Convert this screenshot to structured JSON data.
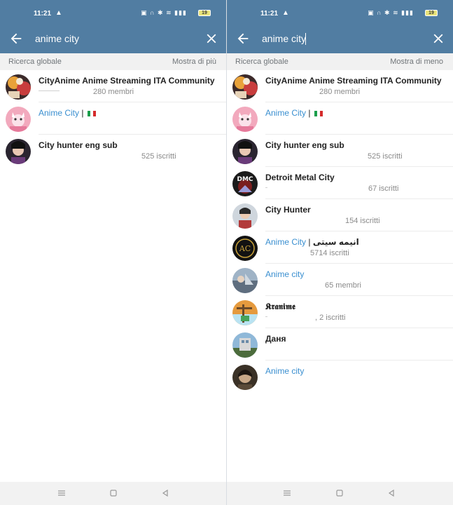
{
  "status": {
    "time": "11:21",
    "battery": "19"
  },
  "left": {
    "search": {
      "value": "anime city"
    },
    "section": {
      "title": "Ricerca globale",
      "toggle": "Mostra di più"
    },
    "results": [
      {
        "title": "CityAnime Anime Streaming ITA Community",
        "subtitle": "280 membri"
      },
      {
        "title": "Anime City",
        "separator": "|"
      },
      {
        "title": "City hunter eng sub",
        "subtitle": "525 iscritti"
      }
    ]
  },
  "right": {
    "search": {
      "value": "anime city"
    },
    "section": {
      "title": "Ricerca globale",
      "toggle": "Mostra di meno"
    },
    "results": [
      {
        "title": "CityAnime Anime Streaming ITA Community",
        "subtitle": "280 membri"
      },
      {
        "title": "Anime City",
        "separator": "|"
      },
      {
        "title": "City hunter eng sub",
        "subtitle": "525 iscritti"
      },
      {
        "title": "Detroit Metal City",
        "subtitle": "67 iscritti",
        "avatar_text": "DMC"
      },
      {
        "title": "City Hunter",
        "subtitle": "154 iscritti"
      },
      {
        "title": "Anime City",
        "separator": "|",
        "title_extra": "انیمه سیتی",
        "subtitle": "5714 iscritti"
      },
      {
        "title": "Anime city",
        "subtitle": "65 membri"
      },
      {
        "title": "𝕶𝖗𝖆𝖓𝖎𝖒𝖊",
        "subtitle": ", 2 iscritti"
      },
      {
        "title": "Даня"
      },
      {
        "title": "Anime city"
      }
    ]
  },
  "colors": {
    "header": "#517da2",
    "link": "#3a8fd0",
    "section_bg": "#f1f1f1"
  }
}
